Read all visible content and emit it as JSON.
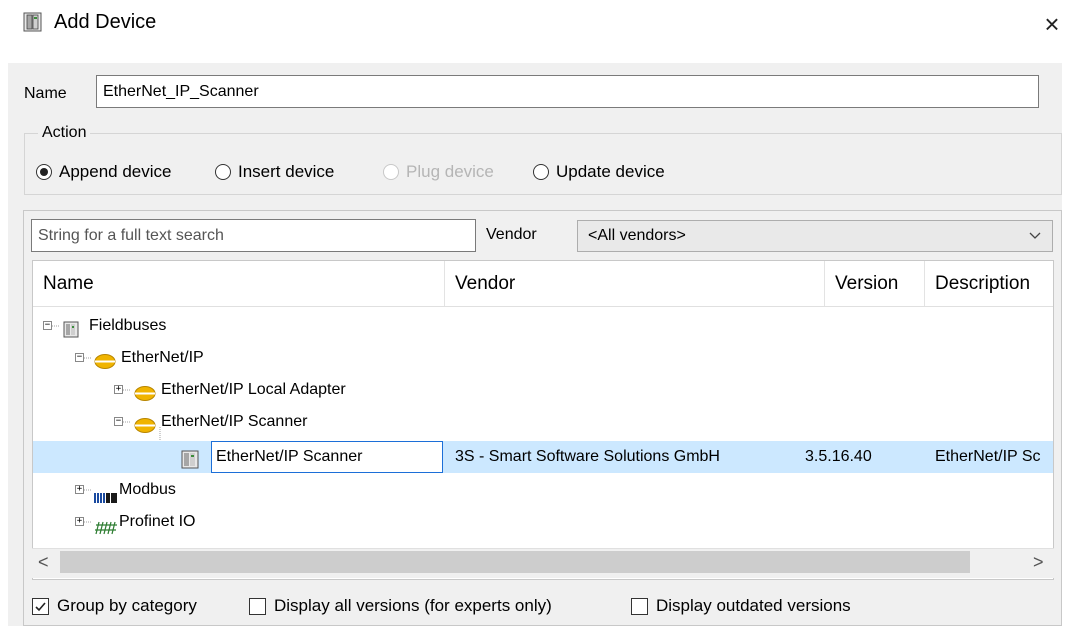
{
  "window": {
    "title": "Add Device",
    "close_glyph": "×",
    "icon": "device-icon"
  },
  "name_field": {
    "label": "Name",
    "value": "EtherNet_IP_Scanner"
  },
  "action": {
    "legend": "Action",
    "options": [
      {
        "label": "Append device",
        "selected": true,
        "enabled": true
      },
      {
        "label": "Insert device",
        "selected": false,
        "enabled": true
      },
      {
        "label": "Plug device",
        "selected": false,
        "enabled": false
      },
      {
        "label": "Update device",
        "selected": false,
        "enabled": true
      }
    ]
  },
  "search": {
    "placeholder": "String for a full text search",
    "value": ""
  },
  "vendor_filter": {
    "label": "Vendor",
    "selected": "<All vendors>"
  },
  "table": {
    "columns": [
      "Name",
      "Vendor",
      "Version",
      "Description"
    ],
    "rows": [
      {
        "name": "Fieldbuses",
        "expander": "−",
        "icon": "fieldbus-icon"
      },
      {
        "name": "EtherNet/IP",
        "expander": "−",
        "icon": "ethernet-ip-icon"
      },
      {
        "name": "EtherNet/IP Local Adapter",
        "expander": "+",
        "icon": "ethernet-ip-icon"
      },
      {
        "name": "EtherNet/IP Scanner",
        "expander": "−",
        "icon": "ethernet-ip-icon"
      },
      {
        "name": "EtherNet/IP Scanner",
        "vendor": "3S - Smart Software Solutions GmbH",
        "version": "3.5.16.40",
        "description": "EtherNet/IP Sc",
        "icon": "device-icon",
        "selected": true
      },
      {
        "name": "Modbus",
        "expander": "+",
        "icon": "modbus-icon"
      },
      {
        "name": "Profinet IO",
        "expander": "+",
        "icon": "profinet-icon"
      }
    ]
  },
  "scrollbar": {
    "left": "<",
    "right": ">"
  },
  "options": [
    {
      "label": "Group by category",
      "checked": true
    },
    {
      "label": "Display all versions (for experts only)",
      "checked": false
    },
    {
      "label": "Display outdated versions",
      "checked": false
    }
  ],
  "colors": {
    "selection": "#cce8ff",
    "focus_border": "#1c6fd8",
    "ethernet_icon": "#f0b400",
    "panel_bg": "#f0f0f0"
  }
}
